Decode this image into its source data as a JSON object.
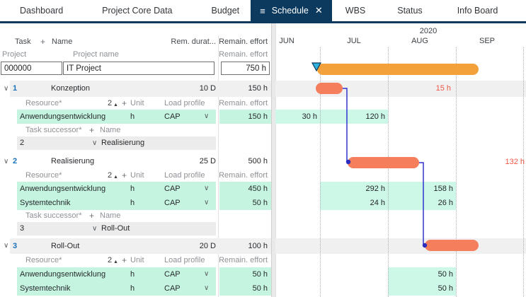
{
  "nav": {
    "tabs": [
      "Dashboard",
      "Project Core Data",
      "Budget",
      "Schedule",
      "WBS",
      "Status",
      "Info Board"
    ],
    "active_tab": "Schedule"
  },
  "icons": {
    "hamburger": "≡",
    "close": "✕",
    "chevron_down": "∨",
    "plus": "+",
    "sort_asc": "▲"
  },
  "table_header": {
    "task": "Task",
    "name": "Name",
    "rem_duration": "Rem. durat...",
    "remain_effort": "Remain. effort",
    "sub_project": "Project",
    "sub_project_name": "Project name",
    "sub_remain_effort": "Remain. effort"
  },
  "labels": {
    "resource": "Resource*",
    "sort_count": "2",
    "unit": "Unit",
    "load_profile": "Load profile",
    "remain_effort": "Remain. effort",
    "task_successor": "Task successor*",
    "name": "Name"
  },
  "project": {
    "id": "000000",
    "name": "IT Project",
    "effort": "750 h"
  },
  "tasks": [
    {
      "number": "1",
      "name": "Konzeption",
      "duration": "10 D",
      "effort": "150 h",
      "overdue_label": "15 h",
      "resources": [
        {
          "name": "Anwendungsentwicklung",
          "unit": "h",
          "load": "CAP",
          "effort": "150 h",
          "month_values": [
            "30 h",
            "120 h"
          ],
          "months": [
            "JUN",
            "JUL"
          ]
        }
      ],
      "successor": {
        "number": "2",
        "name": "Realisierung"
      }
    },
    {
      "number": "2",
      "name": "Realisierung",
      "duration": "25 D",
      "effort": "500 h",
      "overdue_label": "132 h",
      "resources": [
        {
          "name": "Anwendungsentwicklung",
          "unit": "h",
          "load": "CAP",
          "effort": "450 h",
          "month_values": [
            "292 h",
            "158 h"
          ],
          "months": [
            "JUL",
            "AUG"
          ]
        },
        {
          "name": "Systemtechnik",
          "unit": "h",
          "load": "CAP",
          "effort": "50 h",
          "month_values": [
            "24 h",
            "26 h"
          ],
          "months": [
            "JUL",
            "AUG"
          ]
        }
      ],
      "successor": {
        "number": "3",
        "name": "Roll-Out"
      }
    },
    {
      "number": "3",
      "name": "Roll-Out",
      "duration": "20 D",
      "effort": "100 h",
      "overdue_label": "",
      "resources": [
        {
          "name": "Anwendungsentwicklung",
          "unit": "h",
          "load": "CAP",
          "effort": "50 h",
          "month_values": [
            "50 h"
          ],
          "months": [
            "AUG"
          ]
        },
        {
          "name": "Systemtechnik",
          "unit": "h",
          "load": "CAP",
          "effort": "50 h",
          "month_values": [
            "50 h"
          ],
          "months": [
            "AUG"
          ]
        }
      ]
    }
  ],
  "gantt": {
    "year": "2020",
    "months": [
      "JUN",
      "JUL",
      "AUG",
      "SEP"
    ],
    "bars": [
      {
        "name": "project",
        "task": "IT Project"
      },
      {
        "name": "task-1",
        "task": "Konzeption"
      },
      {
        "name": "task-2",
        "task": "Realisierung"
      },
      {
        "name": "task-3",
        "task": "Roll-Out"
      }
    ]
  },
  "colors": {
    "navy": "#0c3a5f",
    "project_bar": "#f3a13a",
    "task_bar": "#f57e5c",
    "overdue_text": "#f25544",
    "resource_row_green": "#c5f5e1",
    "gantt_green": "#cdf7e7",
    "connector_blue": "#3032d1",
    "constraint_marker": "#31b2dc"
  }
}
